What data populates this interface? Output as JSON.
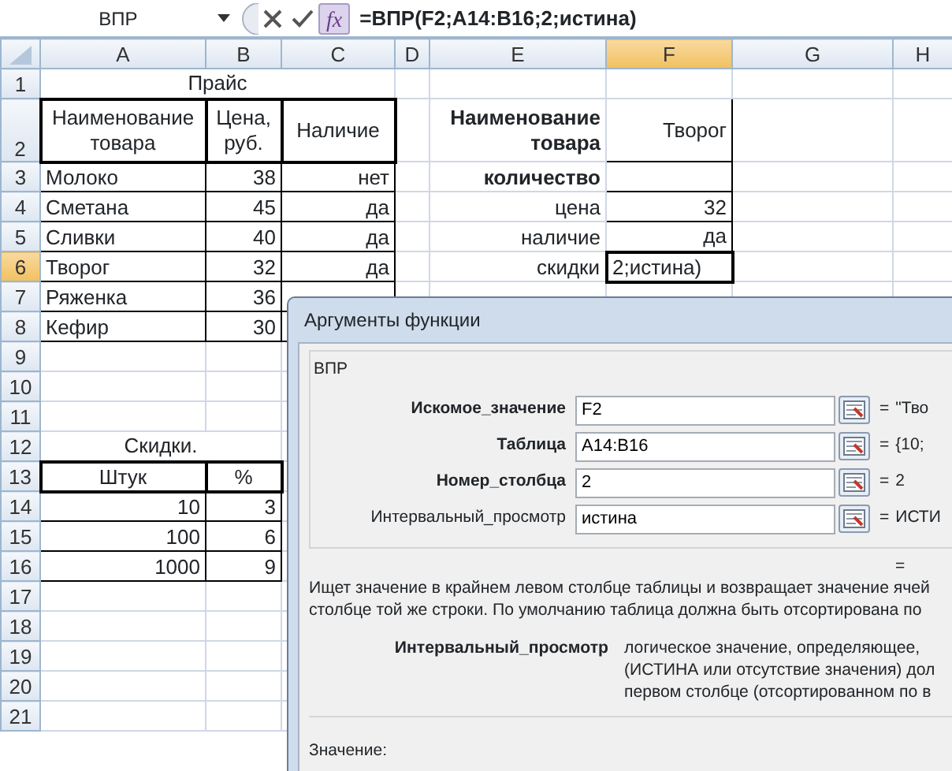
{
  "formula_bar": {
    "name_box": "ВПР",
    "fx": "fx",
    "formula": "=ВПР(F2;A14:B16;2;истина)"
  },
  "columns": [
    {
      "label": "A",
      "selected": false
    },
    {
      "label": "B",
      "selected": false
    },
    {
      "label": "C",
      "selected": false
    },
    {
      "label": "D",
      "selected": false
    },
    {
      "label": "E",
      "selected": false
    },
    {
      "label": "F",
      "selected": true
    },
    {
      "label": "G",
      "selected": false
    },
    {
      "label": "H",
      "selected": false
    }
  ],
  "rows": [
    {
      "number": "1",
      "selected": false,
      "cells": {
        "A": "Прайс"
      }
    },
    {
      "number": "2",
      "selected": false,
      "cells": {
        "A": "Наименование товара",
        "B": "Цена, руб.",
        "C": "Наличие",
        "E": "Наименование товара",
        "F": "Творог"
      }
    },
    {
      "number": "3",
      "selected": false,
      "cells": {
        "A": "Молоко",
        "B": "38",
        "C": "нет",
        "E": "количество"
      }
    },
    {
      "number": "4",
      "selected": false,
      "cells": {
        "A": "Сметана",
        "B": "45",
        "C": "да",
        "E": "цена",
        "F": "32"
      }
    },
    {
      "number": "5",
      "selected": false,
      "cells": {
        "A": "Сливки",
        "B": "40",
        "C": "да",
        "E": "наличие",
        "F": "да"
      }
    },
    {
      "number": "6",
      "selected": true,
      "cells": {
        "A": "Творог",
        "B": "32",
        "C": "да",
        "E": "скидки",
        "F": "2;истина)"
      }
    },
    {
      "number": "7",
      "selected": false,
      "cells": {
        "A": "Ряженка",
        "B": "36"
      }
    },
    {
      "number": "8",
      "selected": false,
      "cells": {
        "A": "Кефир",
        "B": "30"
      }
    },
    {
      "number": "9",
      "selected": false,
      "cells": {}
    },
    {
      "number": "10",
      "selected": false,
      "cells": {}
    },
    {
      "number": "11",
      "selected": false,
      "cells": {}
    },
    {
      "number": "12",
      "selected": false,
      "cells": {
        "A": "Скидки."
      }
    },
    {
      "number": "13",
      "selected": false,
      "cells": {
        "A": "Штук",
        "B": "%"
      }
    },
    {
      "number": "14",
      "selected": false,
      "cells": {
        "A": "10",
        "B": "3"
      }
    },
    {
      "number": "15",
      "selected": false,
      "cells": {
        "A": "100",
        "B": "6"
      }
    },
    {
      "number": "16",
      "selected": false,
      "cells": {
        "A": "1000",
        "B": "9"
      }
    },
    {
      "number": "17",
      "selected": false,
      "cells": {}
    },
    {
      "number": "18",
      "selected": false,
      "cells": {}
    },
    {
      "number": "19",
      "selected": false,
      "cells": {}
    },
    {
      "number": "20",
      "selected": false,
      "cells": {}
    },
    {
      "number": "21",
      "selected": false,
      "cells": {}
    }
  ],
  "dialog": {
    "title": "Аргументы функции",
    "function": "ВПР",
    "arguments": [
      {
        "label": "Искомое_значение",
        "bold": true,
        "value": "F2",
        "equals": "=",
        "result": "\"Тво"
      },
      {
        "label": "Таблица",
        "bold": true,
        "value": "A14:B16",
        "equals": "=",
        "result": "{10;"
      },
      {
        "label": "Номер_столбца",
        "bold": true,
        "value": "2",
        "equals": "=",
        "result": "2"
      },
      {
        "label": "Интервальный_просмотр",
        "bold": false,
        "value": "истина",
        "equals": "=",
        "result": "ИСТИ"
      }
    ],
    "total_equals": "=",
    "description": [
      "Ищет значение в крайнем левом столбце таблицы и возвращает значение ячей",
      "столбце той же строки. По умолчанию таблица должна быть отсортирована по"
    ],
    "help_argument": "Интервальный_просмотр",
    "help_text": [
      "логическое значение, определяющее,",
      "(ИСТИНА или отсутствие значения) дол",
      "первом столбце (отсортированном по в"
    ],
    "value_label": "Значение:"
  }
}
